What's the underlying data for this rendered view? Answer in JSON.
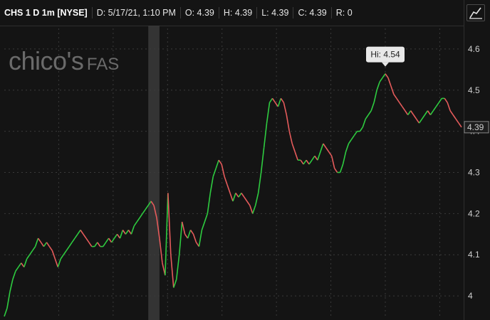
{
  "header": {
    "symbol": "CHS 1 D 1m [NYSE]",
    "date": "D: 5/17/21, 1:10 PM",
    "open": "O: 4.39",
    "high": "H: 4.39",
    "low": "L: 4.39",
    "close": "C: 4.39",
    "range": "R: 0"
  },
  "logo": {
    "text_main": "chico's",
    "text_fas": "FAS"
  },
  "colors": {
    "up": "#2ecc40",
    "down": "#e55b5b",
    "background": "#141414",
    "grid": "#3a3a3a"
  },
  "icons": {
    "chart_type": "line-chart-icon"
  },
  "chart_data": {
    "type": "line",
    "title": "",
    "xlabel": "",
    "ylabel": "",
    "ylim": [
      3.95,
      4.65
    ],
    "yticks": [
      4.0,
      4.1,
      4.2,
      4.3,
      4.4,
      4.5,
      4.6
    ],
    "ytick_labels": [
      "4",
      "4.1",
      "4.2",
      "4.3",
      "4.4",
      "4.5",
      "4.6"
    ],
    "price_label": "4.39",
    "high_marker": {
      "label": "Hi: 4.54",
      "value": 4.54
    },
    "series": [
      {
        "values": [
          3.95,
          3.97,
          4.01,
          4.04,
          4.06,
          4.07,
          4.08,
          4.07,
          4.09,
          4.1,
          4.11,
          4.12,
          4.14,
          4.13,
          4.12,
          4.13,
          4.12,
          4.11,
          4.09,
          4.07,
          4.09,
          4.1,
          4.11,
          4.12,
          4.13,
          4.14,
          4.15,
          4.16,
          4.15,
          4.14,
          4.13,
          4.12,
          4.12,
          4.13,
          4.12,
          4.12,
          4.13,
          4.14,
          4.13,
          4.14,
          4.15,
          4.14,
          4.16,
          4.15,
          4.16,
          4.15,
          4.17,
          4.18,
          4.19,
          4.2,
          4.21,
          4.22,
          4.23,
          4.22,
          4.19,
          4.14,
          4.08,
          4.05,
          4.25,
          4.1,
          4.02,
          4.04,
          4.1,
          4.18,
          4.15,
          4.14,
          4.16,
          4.15,
          4.13,
          4.12,
          4.16,
          4.18,
          4.2,
          4.25,
          4.29,
          4.31,
          4.33,
          4.32,
          4.29,
          4.27,
          4.25,
          4.23,
          4.25,
          4.24,
          4.25,
          4.24,
          4.23,
          4.22,
          4.2,
          4.22,
          4.25,
          4.3,
          4.36,
          4.42,
          4.47,
          4.48,
          4.47,
          4.46,
          4.48,
          4.47,
          4.44,
          4.4,
          4.37,
          4.35,
          4.33,
          4.33,
          4.32,
          4.33,
          4.32,
          4.33,
          4.34,
          4.33,
          4.35,
          4.37,
          4.36,
          4.35,
          4.34,
          4.31,
          4.3,
          4.3,
          4.32,
          4.35,
          4.37,
          4.38,
          4.39,
          4.4,
          4.4,
          4.41,
          4.43,
          4.44,
          4.45,
          4.47,
          4.5,
          4.52,
          4.53,
          4.54,
          4.53,
          4.51,
          4.49,
          4.48,
          4.47,
          4.46,
          4.45,
          4.44,
          4.45,
          4.44,
          4.43,
          4.42,
          4.43,
          4.44,
          4.45,
          4.44,
          4.45,
          4.46,
          4.47,
          4.48,
          4.48,
          4.47,
          4.45,
          4.44,
          4.43,
          4.42,
          4.41
        ]
      }
    ],
    "highlight_index_range": [
      50,
      55
    ]
  }
}
